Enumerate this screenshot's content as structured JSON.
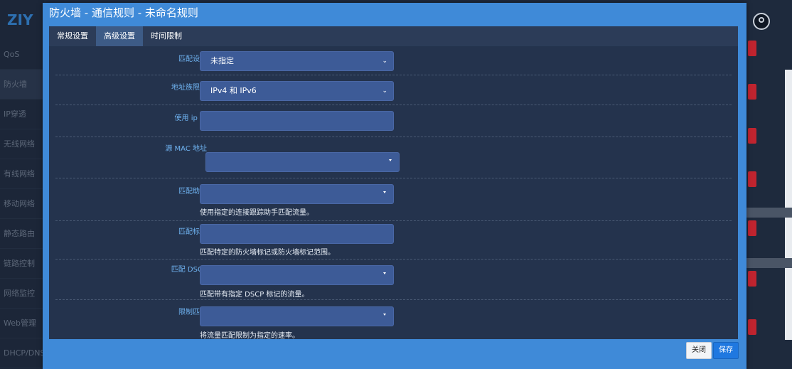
{
  "background": {
    "logo_text": "ZIY",
    "menu": [
      "QoS",
      "防火墙",
      "IP穿透",
      "无线网络",
      "有线网络",
      "移动网络",
      "静态路由",
      "链路控制",
      "网络监控",
      "Web管理",
      "DHCP/DNS"
    ]
  },
  "modal": {
    "title": "防火墙 - 通信规则 - 未命名规则",
    "tabs": [
      "常规设置",
      "高级设置",
      "时间限制"
    ],
    "active_tab": "高级设置",
    "fields": [
      {
        "label": "匹配设备",
        "value": "未指定",
        "help": ""
      },
      {
        "label": "地址族限制",
        "value": "IPv4 和 IPv6",
        "help": ""
      },
      {
        "label": "使用 ip 集",
        "value": "",
        "help": ""
      },
      {
        "label": "源 MAC 地址",
        "value": "",
        "help": ""
      },
      {
        "label": "匹配助手",
        "value": "",
        "help": "使用指定的连接跟踪助手匹配流量。"
      },
      {
        "label": "匹配标记",
        "value": "",
        "help": "匹配特定的防火墙标记或防火墙标记范围。"
      },
      {
        "label": "匹配 DSCP",
        "value": "",
        "help": "匹配带有指定 DSCP 标记的流量。"
      },
      {
        "label": "限制匹配",
        "value": "",
        "help": "将流量匹配限制为指定的速率。"
      }
    ],
    "buttons": {
      "close": "关闭",
      "save": "保存"
    }
  },
  "colors": {
    "modal_frame": "#3f8ad8",
    "content_bg": "#24334d",
    "field_bg": "#3d5b97",
    "label": "#6fb3f1",
    "save_button": "#1f78e0"
  }
}
